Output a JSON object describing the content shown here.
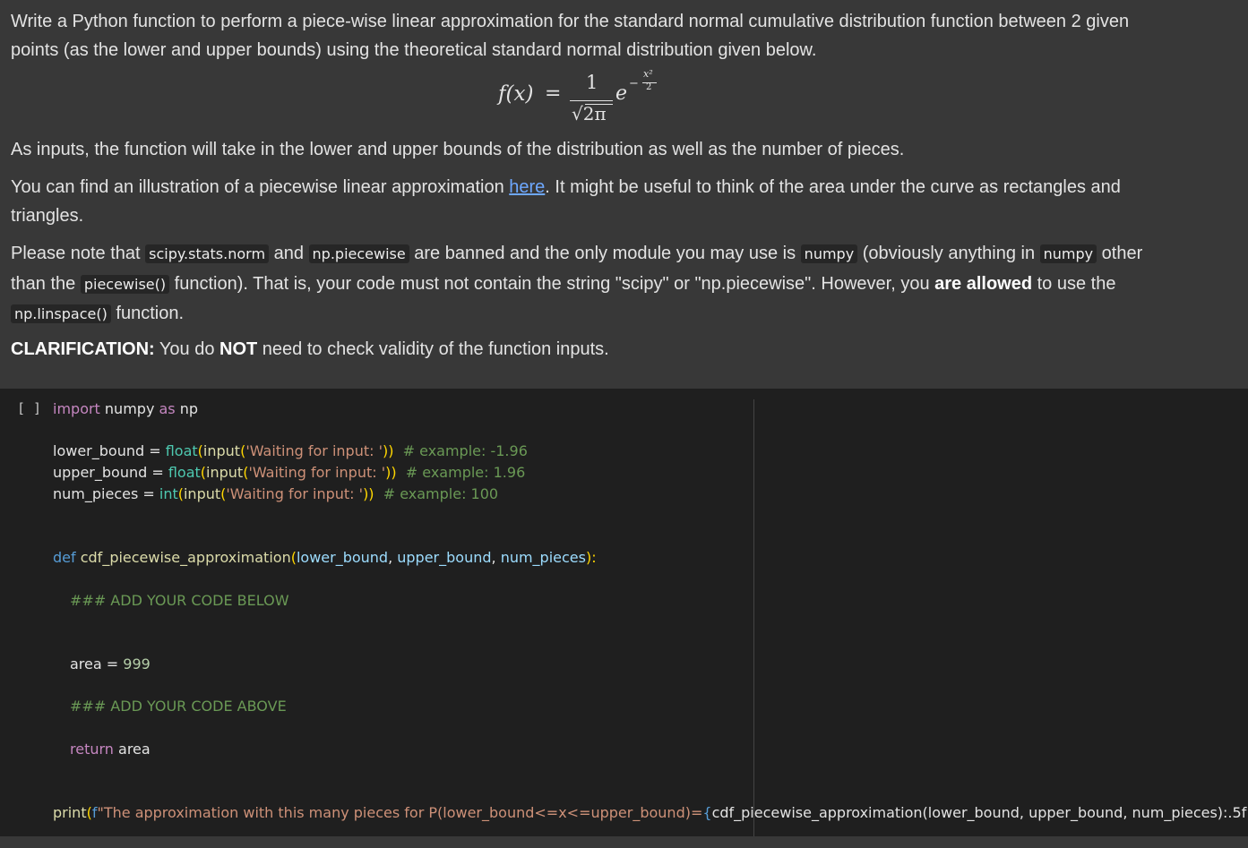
{
  "text_cell": {
    "p1": "Write a Python function to perform a piece-wise linear approximation for the standard normal cumulative distribution function between 2 given points (as the lower and upper bounds) using the theoretical standard normal distribution given below.",
    "formula": {
      "lhs": "f(x)",
      "eq": "=",
      "num": "1",
      "den": "2π",
      "base": "e",
      "exp_minus": "−",
      "exp_num": "x²",
      "exp_den": "2"
    },
    "p2": "As inputs, the function will take in the lower and upper bounds of the distribution as well as the number of pieces.",
    "p3_a": "You can find an illustration of a piecewise linear approximation ",
    "p3_link": "here",
    "p3_b": ". It might be useful to think of the area under the curve as rectangles and triangles.",
    "p4_a": "Please note that ",
    "p4_code1": "scipy.stats.norm",
    "p4_b": " and ",
    "p4_code2": "np.piecewise",
    "p4_c": " are banned and the only module you may use is ",
    "p4_code3": "numpy",
    "p4_d": " (obviously anything in ",
    "p4_code4": "numpy",
    "p4_e": " other than the ",
    "p4_code5": "piecewise()",
    "p4_f": " function). That is, your code must not contain the string \"scipy\" or \"np.piecewise\". However, you ",
    "p4_bold": "are allowed",
    "p4_g": " to use the ",
    "p4_code6": "np.linspace()",
    "p4_h": " function.",
    "p5_bold1": "CLARIFICATION:",
    "p5_a": " You do ",
    "p5_bold2": "NOT",
    "p5_b": " need to check validity of the function inputs."
  },
  "code_cell": {
    "bracket": "[ ]",
    "line1": {
      "kw1": "import",
      "mod": " numpy ",
      "kw2": "as",
      "alias": " np"
    },
    "line2": {
      "var": "lower_bound = ",
      "fn1": "float",
      "p1": "(",
      "fn2": "input",
      "p2": "(",
      "str": "'Waiting for input: '",
      "p3": "))  ",
      "cm": "# example: -1.96"
    },
    "line3": {
      "var": "upper_bound = ",
      "fn1": "float",
      "p1": "(",
      "fn2": "input",
      "p2": "(",
      "str": "'Waiting for input: '",
      "p3": "))  ",
      "cm": "# example: 1.96"
    },
    "line4": {
      "var": "num_pieces = ",
      "fn1": "int",
      "p1": "(",
      "fn2": "input",
      "p2": "(",
      "str": "'Waiting for input: '",
      "p3": "))  ",
      "cm": "# example: 100"
    },
    "line5": {
      "kw": "def",
      "name": " cdf_piecewise_approximation",
      "open": "(",
      "a1": "lower_bound",
      "sep1": ", ",
      "a2": "upper_bound",
      "sep2": ", ",
      "a3": "num_pieces",
      "close": "):"
    },
    "line6": {
      "cm": "### ADD YOUR CODE BELOW"
    },
    "line7": {
      "var": "area = ",
      "num": "999"
    },
    "line8": {
      "cm": "### ADD YOUR CODE ABOVE"
    },
    "line9": {
      "kw": "return",
      "var": " area"
    },
    "line10": {
      "fn": "print",
      "p1": "(",
      "fpre": "f",
      "s1": "\"The approximation with this many pieces for P(lower_bound<=x<=upper_bound)=",
      "b1": "{",
      "call": "cdf_piecewise_approximation(lower_bound, upper_bound, num_pieces):.5f",
      "b2": "}",
      "s2": "\"",
      "p2": ")"
    }
  }
}
